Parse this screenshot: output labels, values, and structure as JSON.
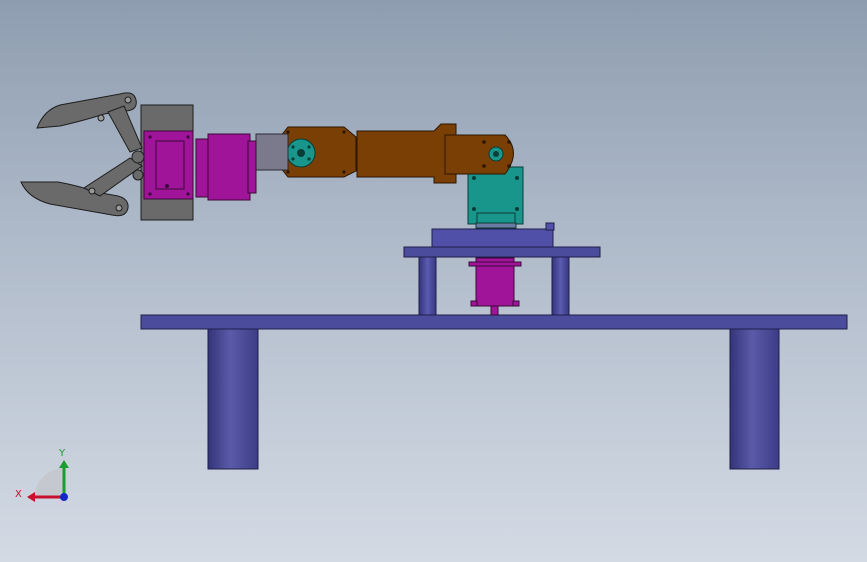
{
  "triad": {
    "x_label": "X",
    "y_label": "Y",
    "x_color": "#c8102e",
    "y_color": "#1a9c2e",
    "z_color": "#1428c8"
  },
  "colors": {
    "table": "#4c4c9c",
    "gripper_plate": "#6a6a6a",
    "motor": "#a0149a",
    "link": "#7a3f05",
    "servo": "#19968c",
    "bracket": "#7a7a8c"
  }
}
